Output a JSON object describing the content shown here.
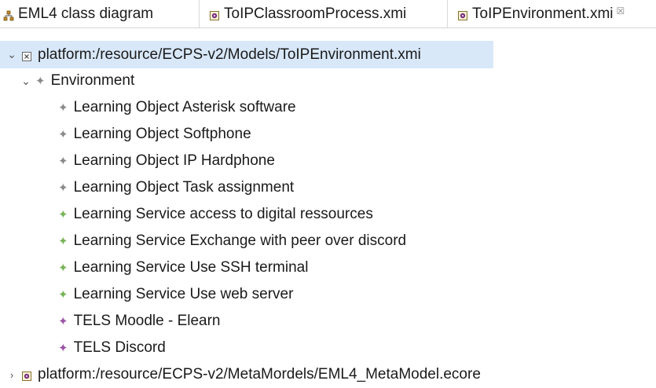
{
  "tabs": [
    {
      "label": "EML4 class diagram",
      "icon": "class-diagram-icon",
      "active": false
    },
    {
      "label": "ToIPClassroomProcess.xmi",
      "icon": "model-file-icon",
      "active": false
    },
    {
      "label": "ToIPEnvironment.xmi",
      "icon": "model-file-icon",
      "active": true,
      "close": "☒"
    }
  ],
  "tree": {
    "root": {
      "label": "platform:/resource/ECPS-v2/Models/ToIPEnvironment.xmi",
      "icon": "xmi-file-icon",
      "expanded": true
    },
    "environment": {
      "label": "Environment",
      "expanded": true
    },
    "children": [
      {
        "label": "Learning Object Asterisk software",
        "kind": "object"
      },
      {
        "label": "Learning Object Softphone",
        "kind": "object"
      },
      {
        "label": "Learning Object IP Hardphone",
        "kind": "object"
      },
      {
        "label": "Learning Object Task assignment",
        "kind": "object"
      },
      {
        "label": "Learning Service access to digital ressources",
        "kind": "service"
      },
      {
        "label": "Learning Service Exchange with peer over discord",
        "kind": "service"
      },
      {
        "label": "Learning Service Use SSH terminal",
        "kind": "service"
      },
      {
        "label": "Learning Service Use web server",
        "kind": "service"
      },
      {
        "label": "TELS Moodle - Elearn",
        "kind": "tels"
      },
      {
        "label": "TELS Discord",
        "kind": "tels"
      }
    ],
    "second_root": {
      "label": "platform:/resource/ECPS-v2/MetaMordels/EML4_MetaModel.ecore",
      "icon": "ecore-package-icon",
      "expanded": false
    }
  },
  "colors": {
    "selection": "#d8e8f9",
    "object": "#8a8a8a",
    "service": "#79b35a",
    "tels": "#9b55a6"
  }
}
